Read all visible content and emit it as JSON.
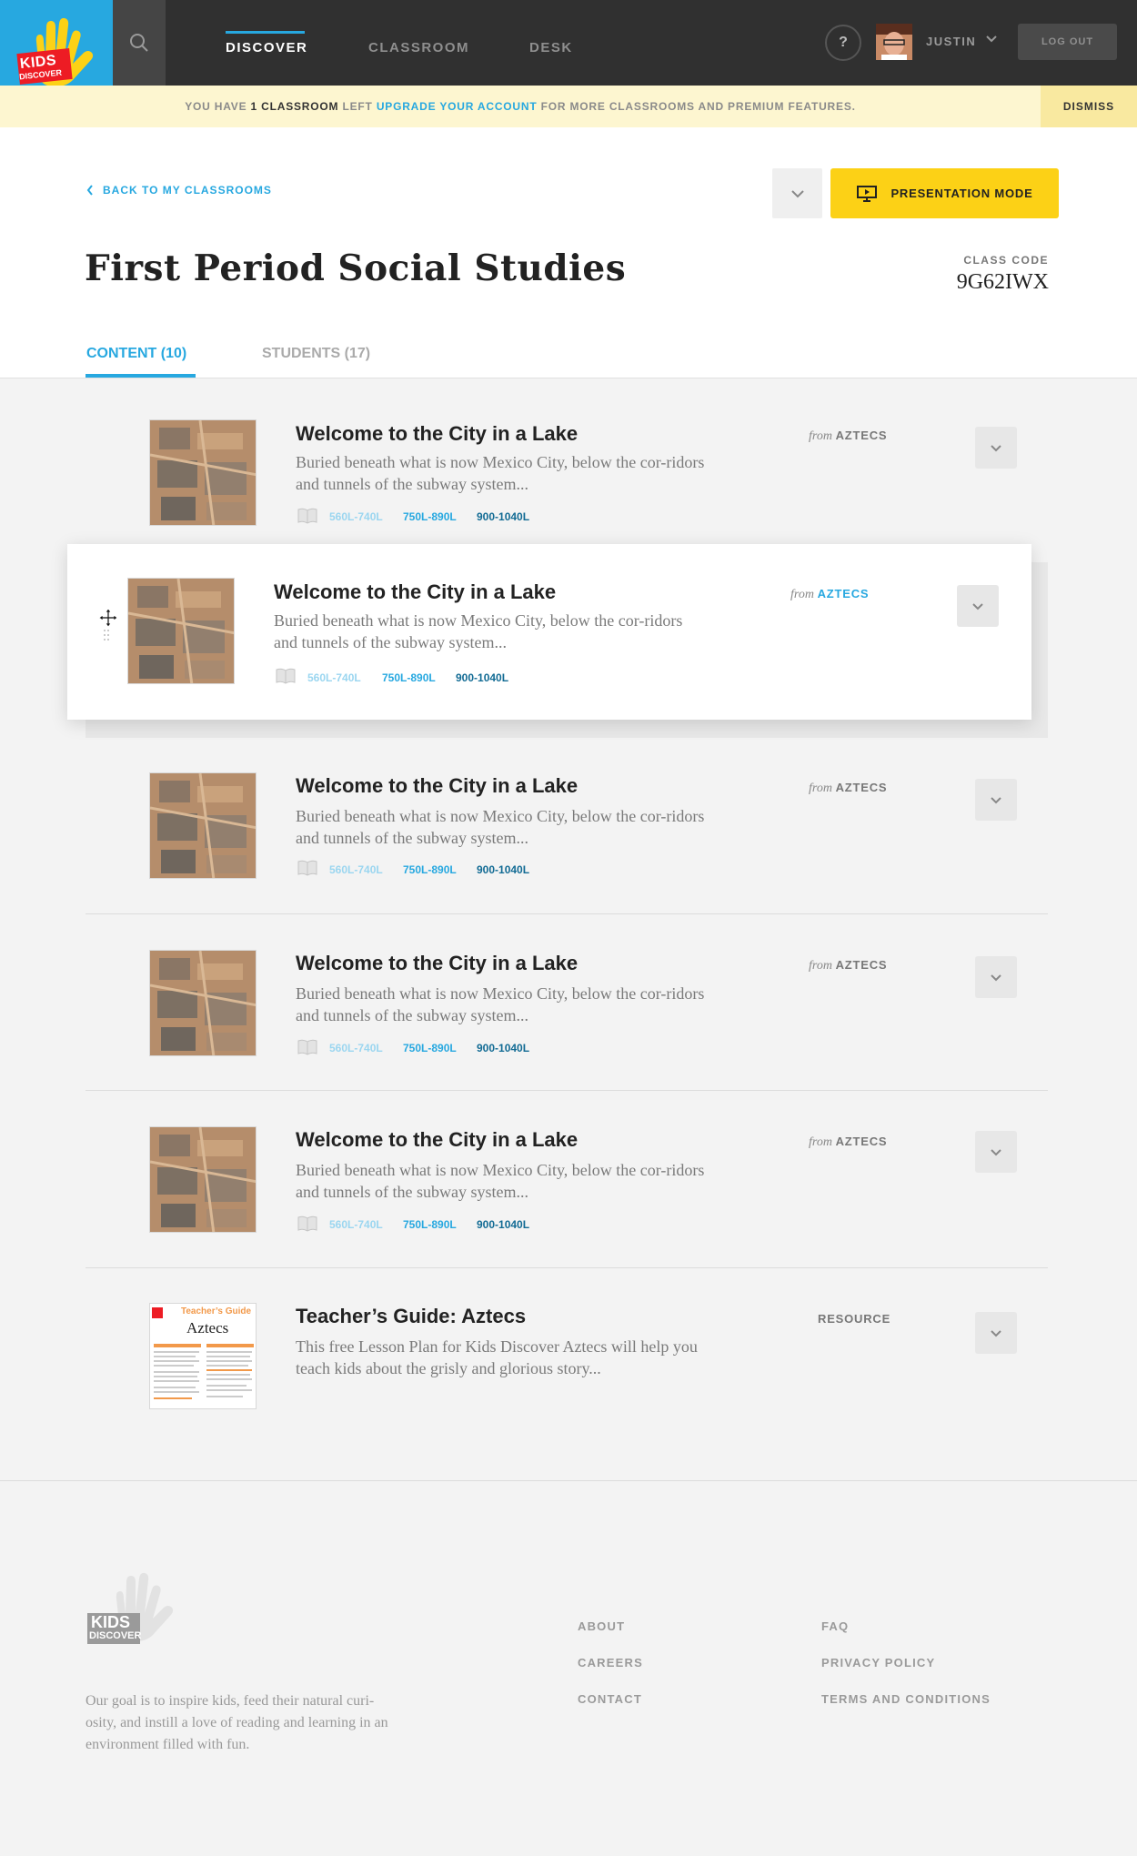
{
  "nav": {
    "logo_line1": "KIDS",
    "logo_line2": "DISCOVER",
    "links": [
      "DISCOVER",
      "CLASSROOM",
      "DESK"
    ],
    "help": "?",
    "username": "JUSTIN",
    "logout": "LOG OUT"
  },
  "banner": {
    "pre": "YOU HAVE ",
    "count": "1 CLASSROOM",
    "mid": " LEFT ",
    "link": "UPGRADE YOUR ACCOUNT",
    "post": " FOR MORE CLASSROOMS AND PREMIUM FEATURES.",
    "dismiss": "DISMISS"
  },
  "header": {
    "back": "BACK TO MY CLASSROOMS",
    "present": "PRESENTATION MODE",
    "title": "First Period Social Studies",
    "code_label": "CLASS CODE",
    "code_value": "9G62IWX",
    "tabs": [
      "CONTENT (10)",
      "STUDENTS (17)"
    ]
  },
  "items": [
    {
      "title": "Welcome to the City in a Lake",
      "desc": "Buried beneath what is now Mexico City, below the cor-ridors and tunnels of the subway system...",
      "from": "from",
      "source": "AZTECS",
      "lexile": [
        "560L-740L",
        "750L-890L",
        "900-1040L"
      ]
    },
    {
      "title": "Welcome to the City in a Lake",
      "desc": "Buried beneath what is now Mexico City, below the cor-ridors and tunnels of the subway system...",
      "from": "from",
      "source": "AZTECS",
      "lexile": [
        "560L-740L",
        "750L-890L",
        "900-1040L"
      ]
    },
    {
      "title": "Welcome to the City in a Lake",
      "desc": "Buried beneath what is now Mexico City, below the cor-ridors and tunnels of the subway system...",
      "from": "from",
      "source": "AZTECS",
      "lexile": [
        "560L-740L",
        "750L-890L",
        "900-1040L"
      ]
    },
    {
      "title": "Welcome to the City in a Lake",
      "desc": "Buried beneath what is now Mexico City, below the cor-ridors and tunnels of the subway system...",
      "from": "from",
      "source": "AZTECS",
      "lexile": [
        "560L-740L",
        "750L-890L",
        "900-1040L"
      ]
    },
    {
      "title": "Welcome to the City in a Lake",
      "desc": "Buried beneath what is now Mexico City, below the cor-ridors and tunnels of the subway system...",
      "from": "from",
      "source": "AZTECS",
      "lexile": [
        "560L-740L",
        "750L-890L",
        "900-1040L"
      ]
    },
    {
      "title": "Teacher’s Guide: Aztecs",
      "desc": "This free Lesson Plan for Kids Discover Aztecs will help you teach kids about the grisly and glorious story...",
      "source": "RESOURCE",
      "thumb_heading": "Teacher’s Guide",
      "thumb_title": "Aztecs"
    }
  ],
  "footer": {
    "mission": "Our goal is to inspire kids, feed their natural curi-osity, and instill a love of reading and learning in an environment filled with fun.",
    "col1": [
      "ABOUT",
      "CAREERS",
      "CONTACT"
    ],
    "col2": [
      "FAQ",
      "PRIVACY POLICY",
      "TERMS AND CONDITIONS"
    ]
  },
  "colors": {
    "accent": "#27a8e0",
    "yellow": "#fcd116",
    "nav": "#303030"
  }
}
